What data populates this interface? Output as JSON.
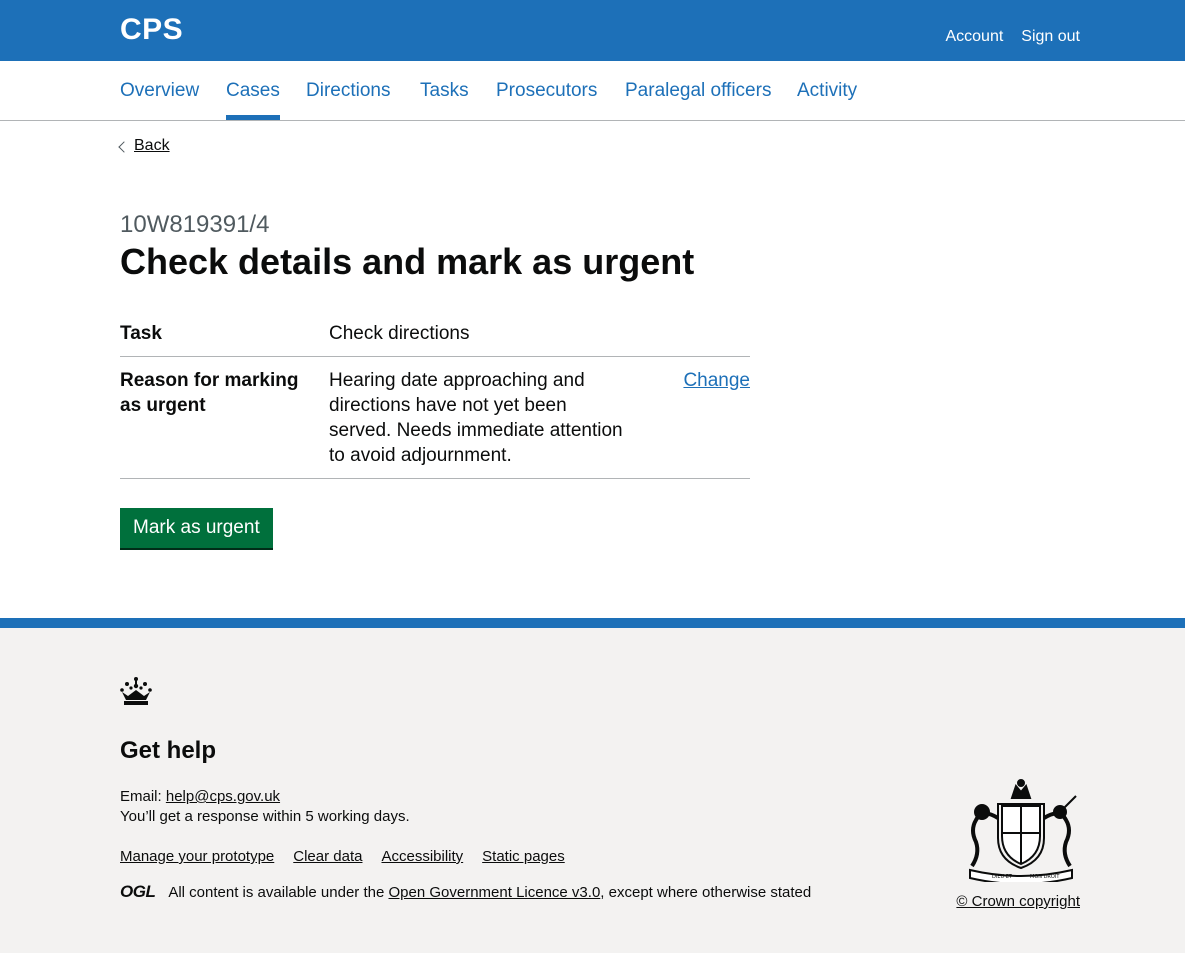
{
  "header": {
    "brand": "CPS",
    "account_link": "Account",
    "signout_link": "Sign out"
  },
  "nav": {
    "items": [
      "Overview",
      "Cases",
      "Directions",
      "Tasks",
      "Prosecutors",
      "Paralegal officers",
      "Activity"
    ],
    "active": "Cases"
  },
  "back_link": "Back",
  "caption": "10W819391/4",
  "title": "Check details and mark as urgent",
  "summary": {
    "rows": [
      {
        "key": "Task",
        "value": "Check directions"
      },
      {
        "key": "Reason for marking as urgent",
        "value": "Hearing date approaching and directions have not yet been served. Needs immediate attention to avoid adjournment.",
        "action": "Change"
      }
    ]
  },
  "button": "Mark as urgent",
  "footer": {
    "heading": "Get help",
    "email_label": "Email:",
    "email": "help@cps.gov.uk",
    "response": "You’ll get a response within 5 working days.",
    "links": [
      "Manage your prototype",
      "Clear data",
      "Accessibility",
      "Static pages"
    ],
    "ogl_logo": "OGL",
    "licence_prefix": "All content is available under the",
    "licence_link": "Open Government Licence v3.0",
    "licence_suffix": ", except where otherwise stated",
    "crest_mottos": [
      "DIEU ET",
      "MON DROIT"
    ],
    "copyright": "© Crown copyright"
  },
  "colors": {
    "brand_blue": "#1d70b8",
    "button_green": "#00703c",
    "footer_bg": "#f3f2f1"
  }
}
